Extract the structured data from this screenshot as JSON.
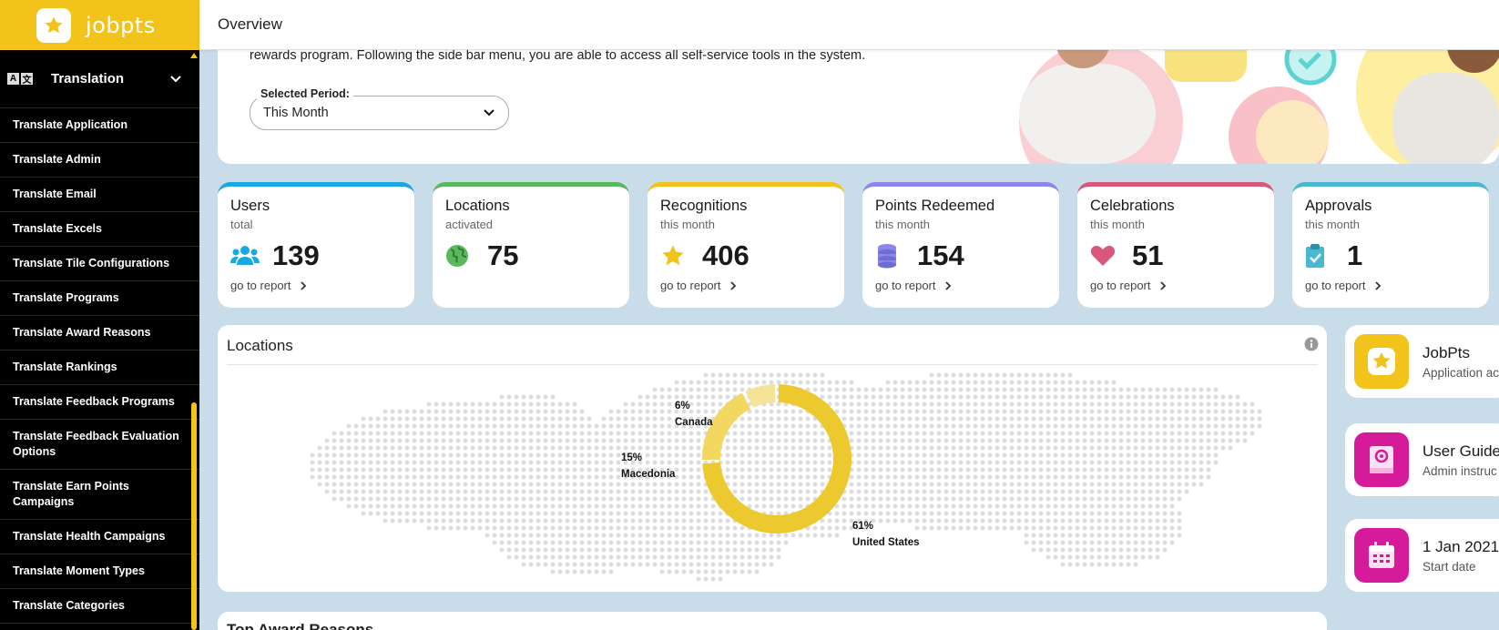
{
  "app": {
    "name": "jobpts"
  },
  "header": {
    "title": "Overview"
  },
  "sidebar": {
    "section": {
      "icon_text": "A文",
      "label": "Translation"
    },
    "items": [
      "Translate Application",
      "Translate Admin",
      "Translate Email",
      "Translate Excels",
      "Translate Tile Configurations",
      "Translate Programs",
      "Translate Award Reasons",
      "Translate Rankings",
      "Translate Feedback Programs",
      "Translate Feedback Evaluation Options",
      "Translate Earn Points Campaigns",
      "Translate Health Campaigns",
      "Translate Moment Types",
      "Translate Categories"
    ]
  },
  "welcome": {
    "text": "rewards program. Following the side bar menu, you are able to access all self-service tools in the system.",
    "period_label": "Selected Period:",
    "period_value": "This Month"
  },
  "cards": [
    {
      "title": "Users",
      "sub": "total",
      "value": "139",
      "link": "go to report",
      "color": "#1aa8e0",
      "icon": "users-icon"
    },
    {
      "title": "Locations",
      "sub": "activated",
      "value": "75",
      "link": "",
      "color": "#5cb85c",
      "icon": "globe-icon"
    },
    {
      "title": "Recognitions",
      "sub": "this month",
      "value": "406",
      "link": "go to report",
      "color": "#f2c31b",
      "icon": "star-icon"
    },
    {
      "title": "Points Redeemed",
      "sub": "this month",
      "value": "154",
      "link": "go to report",
      "color": "#8b88e8",
      "icon": "coins-icon"
    },
    {
      "title": "Celebrations",
      "sub": "this month",
      "value": "51",
      "link": "go to report",
      "color": "#d9577a",
      "icon": "heart-icon"
    },
    {
      "title": "Approvals",
      "sub": "this month",
      "value": "1",
      "link": "go to report",
      "color": "#4ab8d0",
      "icon": "clipboard-check-icon"
    }
  ],
  "locations": {
    "title": "Locations",
    "chart_data": {
      "type": "pie",
      "slices": [
        {
          "label": "United States",
          "pct_text": "61%",
          "value": 61
        },
        {
          "label": "Macedonia",
          "pct_text": "15%",
          "value": 15
        },
        {
          "label": "Canada",
          "pct_text": "6%",
          "value": 6
        }
      ]
    }
  },
  "tiles": [
    {
      "title": "JobPts",
      "sub": "Application ac",
      "icon": "star-app-icon",
      "color": "#f2c31b"
    },
    {
      "title": "User Guide",
      "sub": "Admin instruc",
      "icon": "book-icon",
      "color": "#d61b9a"
    },
    {
      "title": "1 Jan 2021",
      "sub": "Start date",
      "icon": "calendar-icon",
      "color": "#d61b9a"
    }
  ],
  "bottom": {
    "title": "Top Award Reasons"
  }
}
